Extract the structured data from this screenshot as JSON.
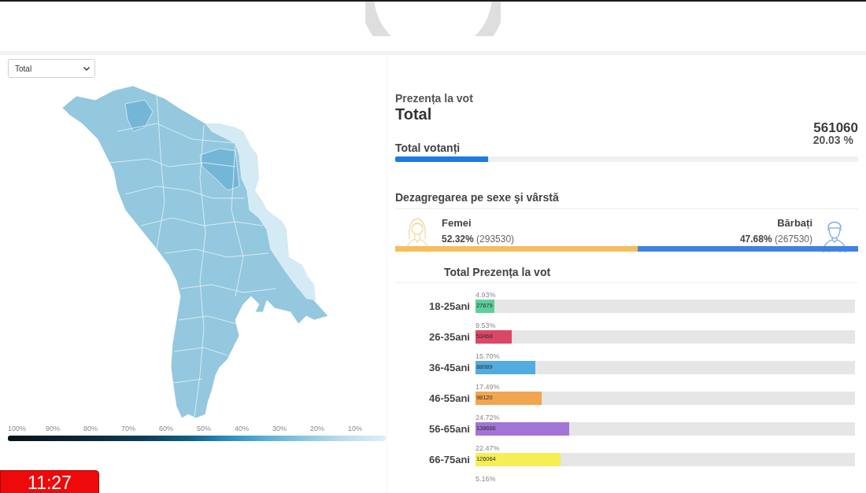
{
  "region_select": {
    "value": "Total"
  },
  "map_legend": [
    "100%",
    "90%",
    "80%",
    "70%",
    "60%",
    "50%",
    "40%",
    "30%",
    "20%",
    "10%"
  ],
  "turnout": {
    "title": "Prezența la vot",
    "subtitle": "Total",
    "total_value": "561060",
    "total_label": "Total votanți",
    "total_percent": "20.03 %",
    "level": 0.2003
  },
  "breakdown": {
    "title": "Dezagregarea pe sexe şi vârstă",
    "groups": [
      {
        "kind": "female",
        "label": "Femei",
        "stats": "**52.32%** (293530)"
      },
      {
        "kind": "male",
        "label": "Bărbați",
        "stats": "**47.68%** (267530)"
      }
    ],
    "level": 0.5232
  },
  "age_chart": {
    "title": "Total Prezența la vot",
    "rows": [
      {
        "label": "18-25ani",
        "percent": "4.93%",
        "value": "27679",
        "level": 0.0493,
        "color": "#5ccf9b"
      },
      {
        "label": "26-35ani",
        "percent": "9.53%",
        "value": "53468",
        "level": 0.0953,
        "color": "#dc4766"
      },
      {
        "label": "36-45ani",
        "percent": "15.70%",
        "value": "88089",
        "level": 0.157,
        "color": "#53ace0"
      },
      {
        "label": "46-55ani",
        "percent": "17.49%",
        "value": "98120",
        "level": 0.1749,
        "color": "#f2a551"
      },
      {
        "label": "56-65ani",
        "percent": "24.72%",
        "value": "138666",
        "level": 0.2472,
        "color": "#a274d6"
      },
      {
        "label": "66-75ani",
        "percent": "22.47%",
        "value": "126064",
        "level": 0.2247,
        "color": "#f5ee55"
      }
    ],
    "partial_row": {
      "percent": "5.16%"
    }
  },
  "clock": {
    "time": "11:27"
  }
}
